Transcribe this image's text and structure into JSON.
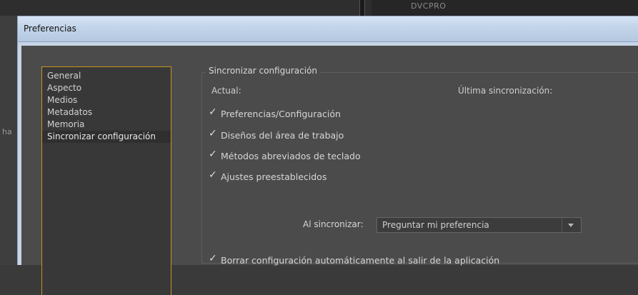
{
  "background": {
    "panel_text": "DVCPRO",
    "left_strip_text": "ha"
  },
  "dialog": {
    "title": "Preferencias"
  },
  "nav": {
    "items": [
      {
        "label": "General"
      },
      {
        "label": "Aspecto"
      },
      {
        "label": "Medios"
      },
      {
        "label": "Metadatos"
      },
      {
        "label": "Memoria"
      },
      {
        "label": "Sincronizar configuración"
      }
    ],
    "selected_index": 5
  },
  "sync": {
    "group_title": "Sincronizar configuración",
    "current_label": "Actual:",
    "last_sync_label": "Última sincronización:",
    "options": [
      {
        "label": "Preferencias/Configuración",
        "checked": true
      },
      {
        "label": "Diseños del área de trabajo",
        "checked": true
      },
      {
        "label": "Métodos abreviados de teclado",
        "checked": true
      },
      {
        "label": "Ajustes preestablecidos",
        "checked": true
      }
    ],
    "on_sync_label": "Al sincronizar:",
    "on_sync_value": "Preguntar mi preferencia",
    "clear_on_exit_label": "Borrar configuración automáticamente al salir de la aplicación",
    "clear_on_exit_checked": true,
    "check_glyph": "✓"
  }
}
